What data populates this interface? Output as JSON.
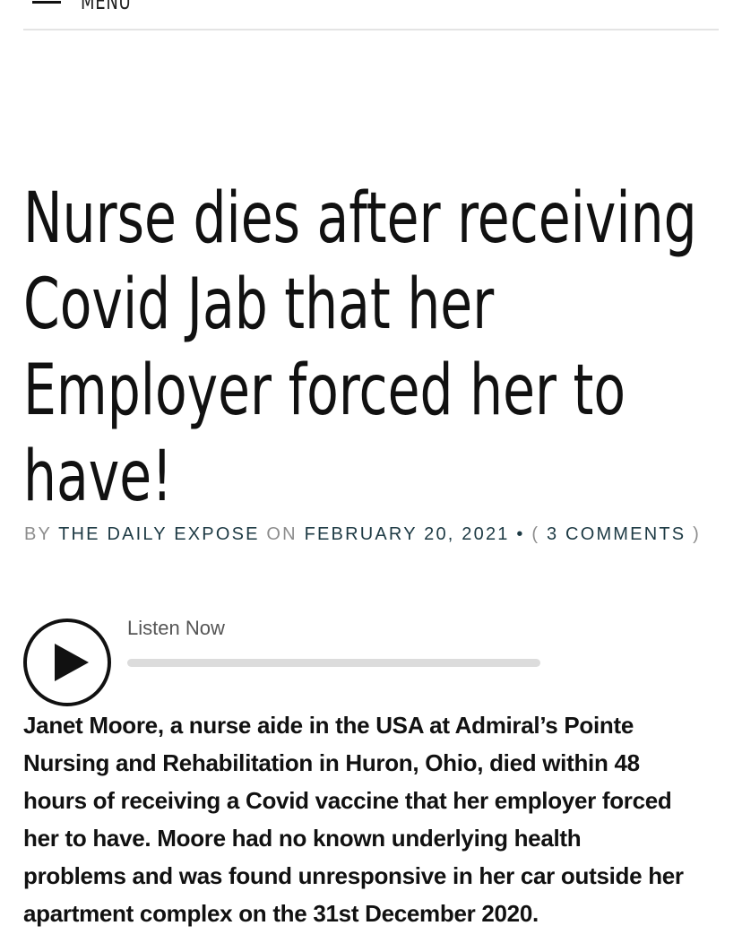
{
  "header": {
    "menu_label": "MENU"
  },
  "article": {
    "title_lines": [
      "Nurse dies after receiving",
      "Covid Jab that her",
      "Employer forced her to",
      "have!"
    ],
    "byline": {
      "by": "BY",
      "author": "THE DAILY EXPOSE",
      "on": "ON",
      "date": "FEBRUARY 20, 2021",
      "separator": "•",
      "open_paren": "(",
      "comments": "3 COMMENTS",
      "close_paren": ")"
    },
    "audio": {
      "label": "Listen Now",
      "progress": 0
    },
    "body_lines": [
      "Janet Moore, a nurse aide in the USA at Admiral’s Pointe",
      "Nursing and Rehabilitation in Huron, Ohio, died within 48",
      "hours of receiving a Covid vaccine that her employer forced",
      "her to have. Moore had no known underlying health",
      "problems and was found unresponsive in her car outside her",
      "apartment complex on the 31st December 2020."
    ]
  }
}
